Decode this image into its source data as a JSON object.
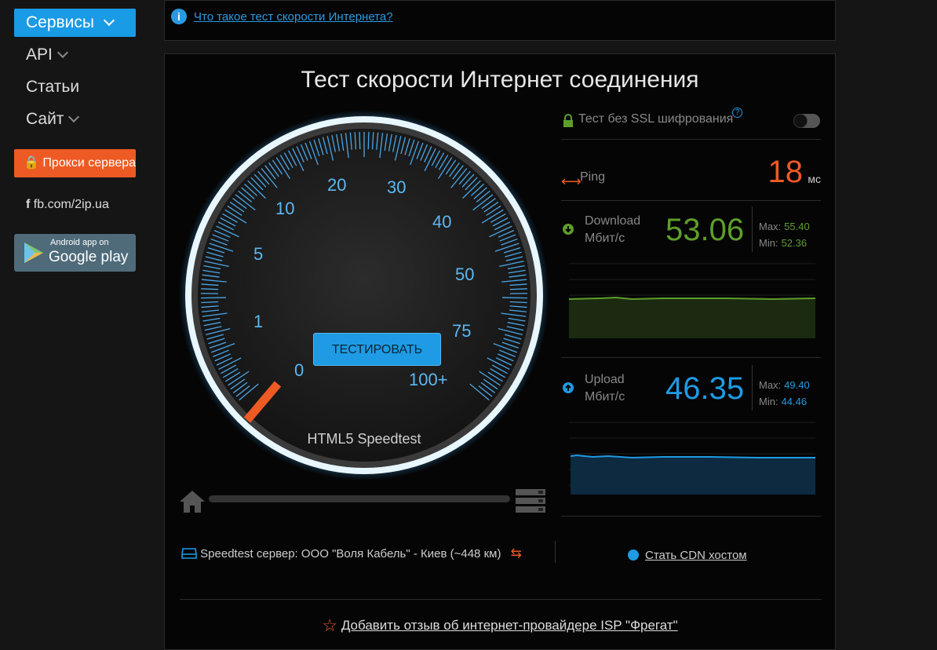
{
  "sidebar": {
    "services_label": "Сервисы",
    "api_label": "API",
    "articles_label": "Статьи",
    "site_label": "Сайт",
    "proxy_label": "Прокси сервера",
    "fb_label": "fb.com/2ip.ua",
    "gplay_small": "Android app on",
    "gplay_big": "Google play"
  },
  "info": {
    "link_text": "Что такое тест скорости Интернета?"
  },
  "main": {
    "title": "Тест скорости Интернет соединения",
    "test_button": "ТЕСТИРОВАТЬ",
    "gauge_caption": "HTML5 Speedtest",
    "gauge_scale": [
      "0",
      "1",
      "5",
      "10",
      "20",
      "30",
      "40",
      "50",
      "75",
      "100+"
    ]
  },
  "panel": {
    "ssl_text": "Тест без SSL шифрования",
    "ssl_help": "?",
    "ping_label": "Ping",
    "ping_value": "18",
    "ping_unit": "мс",
    "download": {
      "label": "Download",
      "unit": "Мбит/с",
      "value": "53.06",
      "max_label": "Max:",
      "max": "55.40",
      "min_label": "Min:",
      "min": "52.36"
    },
    "upload": {
      "label": "Upload",
      "unit": "Мбит/с",
      "value": "46.35",
      "max_label": "Max:",
      "max": "49.40",
      "min_label": "Min:",
      "min": "44.46"
    }
  },
  "footer": {
    "server": "Speedtest сервер: ООО \"Воля Кабель\" - Киев (~448 км)",
    "cdn": "Стать CDN хостом",
    "review": "Добавить отзыв об интернет-провайдере ISP \"Фрегат\""
  },
  "colors": {
    "accent": "#1a9be6",
    "proxy": "#ee5a24",
    "download": "#5e9e2a",
    "upload": "#1e9be4",
    "ping": "#ee5a24"
  }
}
